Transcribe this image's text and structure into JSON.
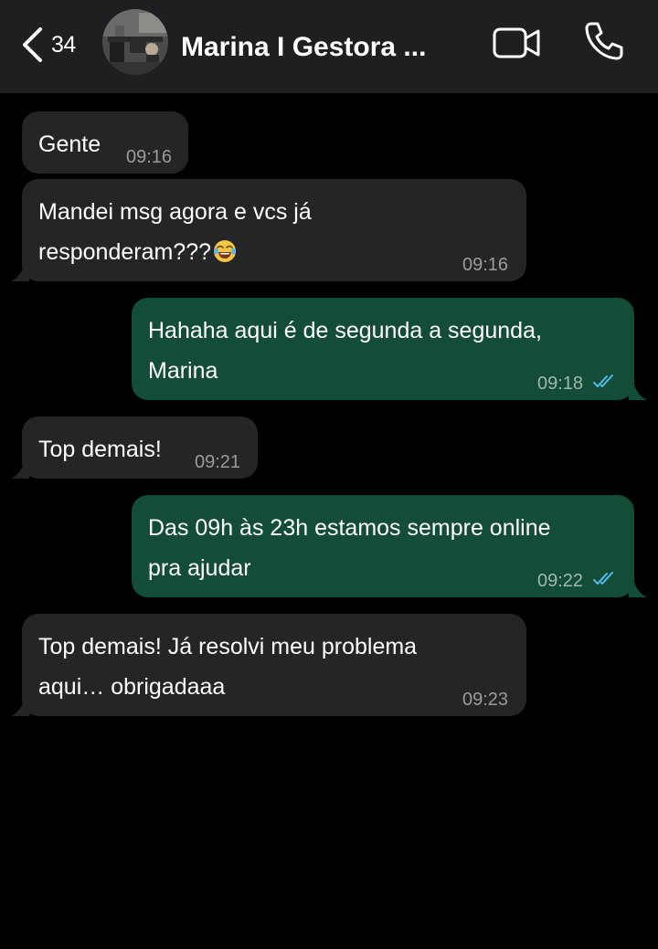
{
  "header": {
    "unread_count": "34",
    "contact_name": "Marina I Gestora ...",
    "background": "#1f1f21"
  },
  "colors": {
    "incoming_bubble": "#242527",
    "outgoing_bubble": "#134d37",
    "read_ticks": "#53bdeb",
    "timestamp": "#9a9b9d"
  },
  "messages": [
    {
      "direction": "in",
      "text": "Gente",
      "time": "09:16"
    },
    {
      "direction": "in",
      "text_line1": "Mandei msg agora e vcs já",
      "text_line2": "responderam???",
      "emoji": "face-with-tears-of-joy",
      "time": "09:16"
    },
    {
      "direction": "out",
      "text_line1": "Hahaha aqui é de segunda a segunda,",
      "text_line2": "Marina",
      "time": "09:18",
      "status": "read"
    },
    {
      "direction": "in",
      "text": "Top demais!",
      "time": "09:21"
    },
    {
      "direction": "out",
      "text_line1": "Das 09h às 23h estamos sempre online",
      "text_line2": "pra ajudar",
      "time": "09:22",
      "status": "read"
    },
    {
      "direction": "in",
      "text_line1": "Top demais! Já resolvi meu problema",
      "text_line2": "aqui… obrigadaaa",
      "time": "09:23"
    }
  ]
}
